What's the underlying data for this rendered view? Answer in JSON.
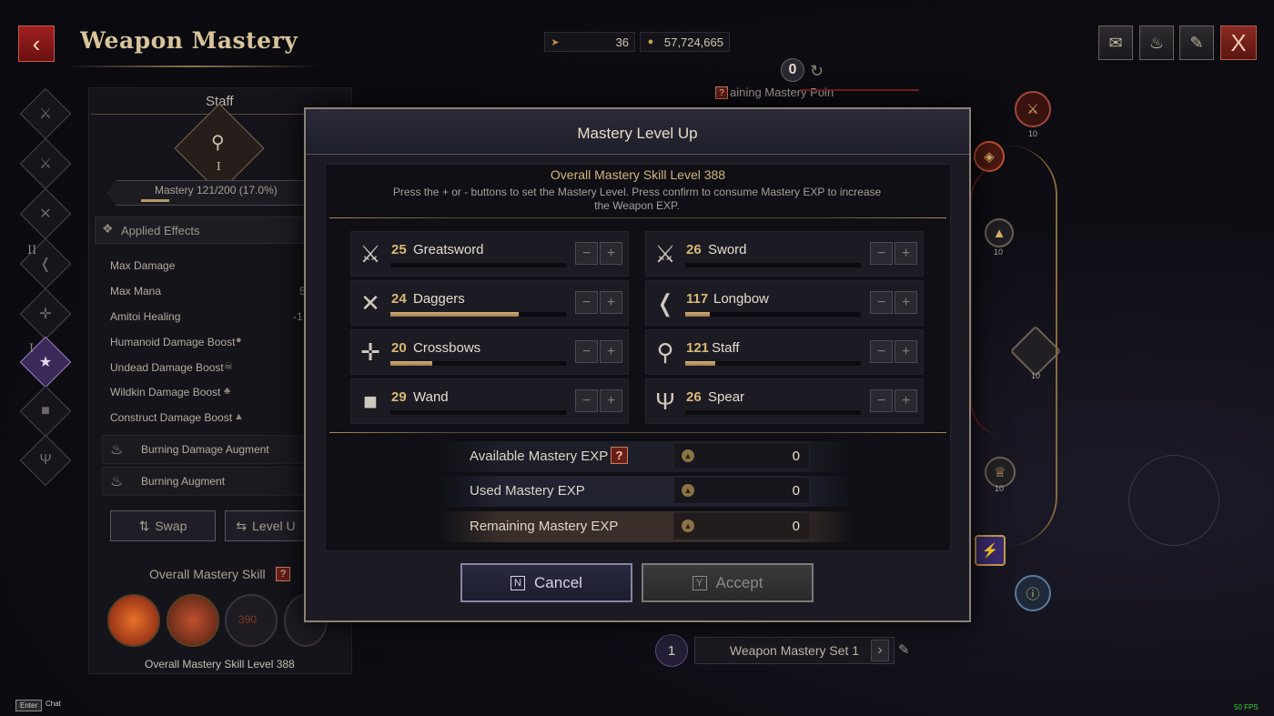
{
  "header": {
    "title": "Weapon Mastery",
    "currency": [
      {
        "icon": "arrow-token-icon",
        "value": "36"
      },
      {
        "icon": "gold-coin-icon",
        "value": "57,724,665"
      }
    ],
    "menu_icons": [
      "mail-icon",
      "campfire-icon",
      "book-icon"
    ],
    "close_label": "X"
  },
  "left_panel": {
    "weapon_name": "Staff",
    "portrait_numeral": "I",
    "mastery_bar": "Mastery 121/200 (17.0%)",
    "mastery_fraction": 0.17,
    "applied_effects_label": "Applied Effects",
    "effects": [
      "Max Damage",
      "Max Mana",
      "Amitoi Healing",
      "Humanoid Damage Boost",
      "Undead Damage Boost",
      "Wildkin Damage Boost",
      "Construct Damage Boost"
    ],
    "effect_values": [
      "",
      "5",
      "-1",
      "",
      "",
      "",
      ""
    ],
    "augments": [
      "Burning Damage Augment",
      "Burning Augment"
    ],
    "swap_label": "Swap",
    "level_label": "Level U",
    "overall_label": "Overall Mastery Skill",
    "overall_level": "Overall Mastery Skill Level 388",
    "skill_slot_value": "390",
    "rail_numerals": [
      "II",
      "I"
    ]
  },
  "tree": {
    "points_value": "0",
    "remaining_label": "aining Mastery Poin",
    "node_levels": [
      "10",
      "10",
      "10",
      "10"
    ]
  },
  "set_selector": {
    "number": "1",
    "label": "Weapon Mastery Set 1"
  },
  "modal": {
    "title": "Mastery Level Up",
    "overall_level": "Overall Mastery Skill Level 388",
    "hint": "Press the + or - buttons to set the Mastery Level. Press confirm to consume Mastery EXP to increase the Weapon EXP.",
    "weapons": [
      {
        "level": "25",
        "name": "Greatsword",
        "progress": 0.0,
        "icon": "greatsword-icon"
      },
      {
        "level": "26",
        "name": "Sword",
        "progress": 0.0,
        "icon": "sword-icon"
      },
      {
        "level": "24",
        "name": "Daggers",
        "progress": 0.73,
        "icon": "daggers-icon"
      },
      {
        "level": "117",
        "name": "Longbow",
        "progress": 0.14,
        "icon": "longbow-icon"
      },
      {
        "level": "20",
        "name": "Crossbows",
        "progress": 0.24,
        "icon": "crossbow-icon"
      },
      {
        "level": "121",
        "name": "Staff",
        "progress": 0.17,
        "icon": "staff-icon"
      },
      {
        "level": "29",
        "name": "Wand",
        "progress": 0.0,
        "icon": "wand-icon"
      },
      {
        "level": "26",
        "name": "Spear",
        "progress": 0.0,
        "icon": "spear-icon"
      }
    ],
    "minus_symbol": "−",
    "plus_symbol": "+",
    "exp": [
      {
        "label": "Available Mastery EXP",
        "value": "0"
      },
      {
        "label": "Used Mastery EXP",
        "value": "0"
      },
      {
        "label": "Remaining Mastery EXP",
        "value": "0"
      }
    ],
    "help": "?",
    "cancel_key": "N",
    "cancel_label": "Cancel",
    "accept_key": "Y",
    "accept_label": "Accept"
  },
  "footer": {
    "enter_key": "Enter",
    "chat_label": "Chat",
    "fps": "50 FPS"
  },
  "colors": {
    "accent_gold": "#d9b977",
    "close_red": "#8a2a22",
    "fps_green": "#3cd23c"
  }
}
